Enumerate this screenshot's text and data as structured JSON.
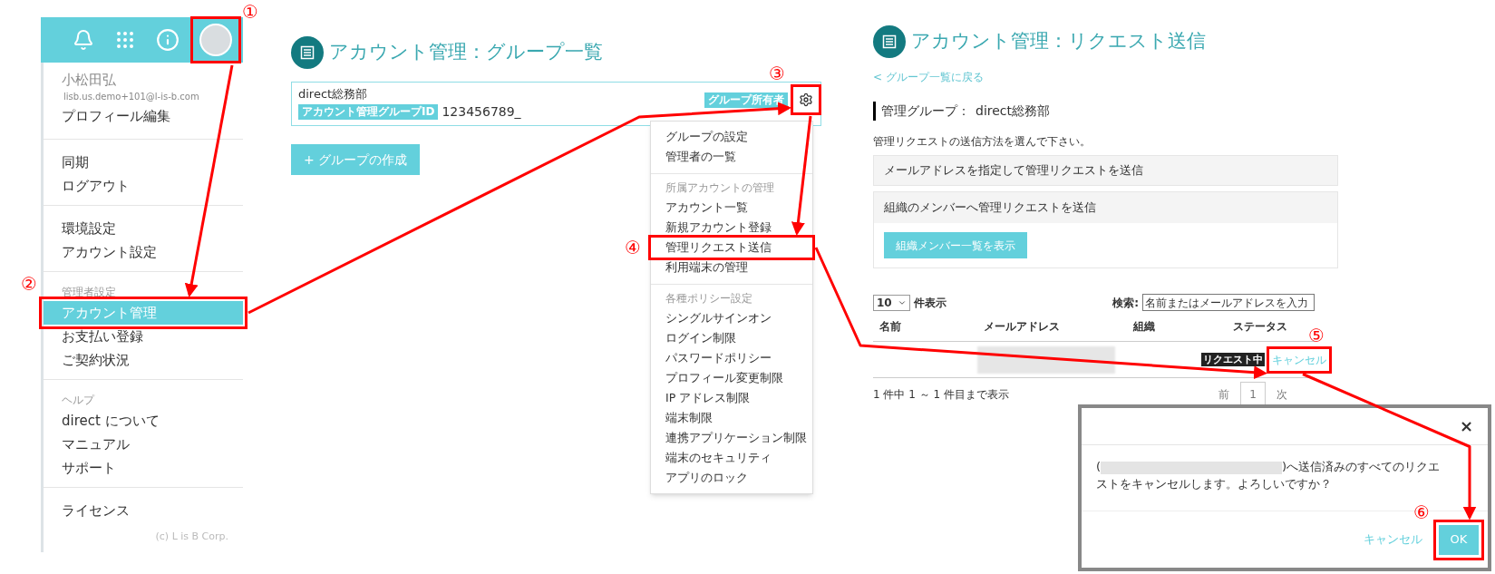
{
  "step_markers": [
    "①",
    "②",
    "③",
    "④",
    "⑤",
    "⑥"
  ],
  "user_menu": {
    "user_name": "小松田弘",
    "email": "lisb.us.demo+101@l-is-b.com",
    "sections": [
      {
        "items": [
          {
            "label": "プロフィール編集",
            "selected": false
          }
        ]
      },
      {
        "items": [
          {
            "label": "同期",
            "selected": false
          },
          {
            "label": "ログアウト",
            "selected": false
          }
        ]
      },
      {
        "items": [
          {
            "label": "環境設定",
            "selected": false
          },
          {
            "label": "アカウント設定",
            "selected": false
          }
        ]
      },
      {
        "header": "管理者設定",
        "items": [
          {
            "label": "アカウント管理",
            "selected": true
          },
          {
            "label": "お支払い登録",
            "selected": false
          },
          {
            "label": "ご契約状況",
            "selected": false
          }
        ]
      },
      {
        "header": "ヘルプ",
        "items": [
          {
            "label": "direct について",
            "selected": false
          },
          {
            "label": "マニュアル",
            "selected": false
          },
          {
            "label": "サポート",
            "selected": false
          }
        ]
      },
      {
        "items": [
          {
            "label": "ライセンス",
            "selected": false
          }
        ]
      }
    ],
    "footer": "(c) L is B Corp."
  },
  "group_list": {
    "title": "アカウント管理：グループ一覧",
    "group": {
      "name": "direct総務部",
      "id_label": "アカウント管理グループID",
      "id": "123456789_",
      "owner_badge": "グループ所有者"
    },
    "create_button": "+ グループの作成",
    "menu": [
      {
        "items": [
          "グループの設定",
          "管理者の一覧"
        ]
      },
      {
        "header": "所属アカウントの管理",
        "items": [
          "アカウント一覧",
          "新規アカウント登録",
          "管理リクエスト送信",
          "利用端末の管理"
        ]
      },
      {
        "header": "各種ポリシー設定",
        "items": [
          "シングルサインオン",
          "ログイン制限",
          "パスワードポリシー",
          "プロフィール変更制限",
          "IP アドレス制限",
          "端末制限",
          "連携アプリケーション制限",
          "端末のセキュリティ",
          "アプリのロック"
        ]
      }
    ]
  },
  "request_page": {
    "title": "アカウント管理：リクエスト送信",
    "back_link": "< グループ一覧に戻る",
    "group_label": "管理グループ：",
    "group_name": "direct総務部",
    "instructions": "管理リクエストの送信方法を選んで下さい。",
    "options": [
      "メールアドレスを指定して管理リクエストを送信",
      "組織のメンバーへ管理リクエストを送信"
    ],
    "show_members_button": "組織メンバー一覧を表示",
    "table": {
      "page_size": "10",
      "page_size_label": "件表示",
      "search_label": "検索:",
      "search_placeholder": "名前またはメールアドレスを入力",
      "columns": [
        "名前",
        "メールアドレス",
        "組織",
        "ステータス"
      ],
      "rows": [
        {
          "status": "リクエスト中",
          "action": "キャンセル"
        }
      ],
      "summary": "1 件中 1 ～ 1 件目まで表示",
      "prev": "前",
      "page": "1",
      "next": "次"
    }
  },
  "dialog": {
    "close": "×",
    "message_start": "(",
    "message_end": ")へ送信済みのすべてのリクエストをキャンセルします。よろしいですか？",
    "cancel": "キャンセル",
    "ok": "OK"
  }
}
